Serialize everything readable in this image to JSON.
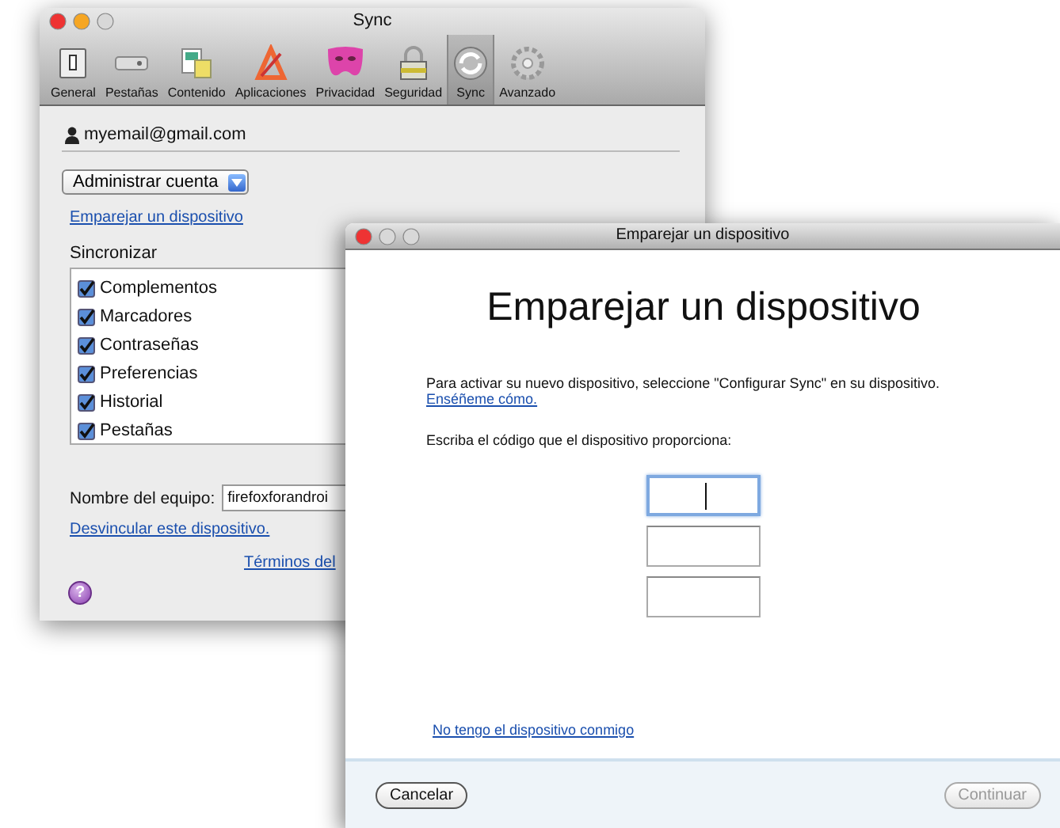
{
  "preferences_window": {
    "title": "Sync",
    "toolbar": [
      {
        "label": "General",
        "selected": false
      },
      {
        "label": "Pestañas",
        "selected": false
      },
      {
        "label": "Contenido",
        "selected": false
      },
      {
        "label": "Aplicaciones",
        "selected": false
      },
      {
        "label": "Privacidad",
        "selected": false
      },
      {
        "label": "Seguridad",
        "selected": false
      },
      {
        "label": "Sync",
        "selected": true
      },
      {
        "label": "Avanzado",
        "selected": false
      }
    ],
    "account_email": "myemail@gmail.com",
    "manage_button": "Administrar cuenta",
    "pair_link": "Emparejar un dispositivo",
    "sync_label": "Sincronizar",
    "sync_items": [
      {
        "label": "Complementos",
        "checked": true
      },
      {
        "label": "Marcadores",
        "checked": true
      },
      {
        "label": "Contraseñas",
        "checked": true
      },
      {
        "label": "Preferencias",
        "checked": true
      },
      {
        "label": "Historial",
        "checked": true
      },
      {
        "label": "Pestañas",
        "checked": true
      }
    ],
    "device_name": {
      "label": "Nombre del equipo:",
      "value": "firefoxforandroi"
    },
    "unlink_link": "Desvincular este dispositivo.",
    "terms_link": "Términos del",
    "help_button": "?"
  },
  "pair_dialog": {
    "title": "Emparejar un dispositivo",
    "heading": "Emparejar un dispositivo",
    "instructions": "Para activar su nuevo dispositivo, seleccione \"Configurar Sync\" en su dispositivo.",
    "help_link": "Enséñeme cómo.",
    "code_prompt": "Escriba el código que el dispositivo proporciona:",
    "code_fields": [
      {
        "focused": true
      },
      {
        "focused": false
      },
      {
        "focused": false
      }
    ],
    "no_device_link": "No tengo el dispositivo conmigo",
    "buttons": [
      {
        "label": "Cancelar",
        "disabled": false
      },
      {
        "label": "Continuar",
        "disabled": true
      }
    ]
  }
}
